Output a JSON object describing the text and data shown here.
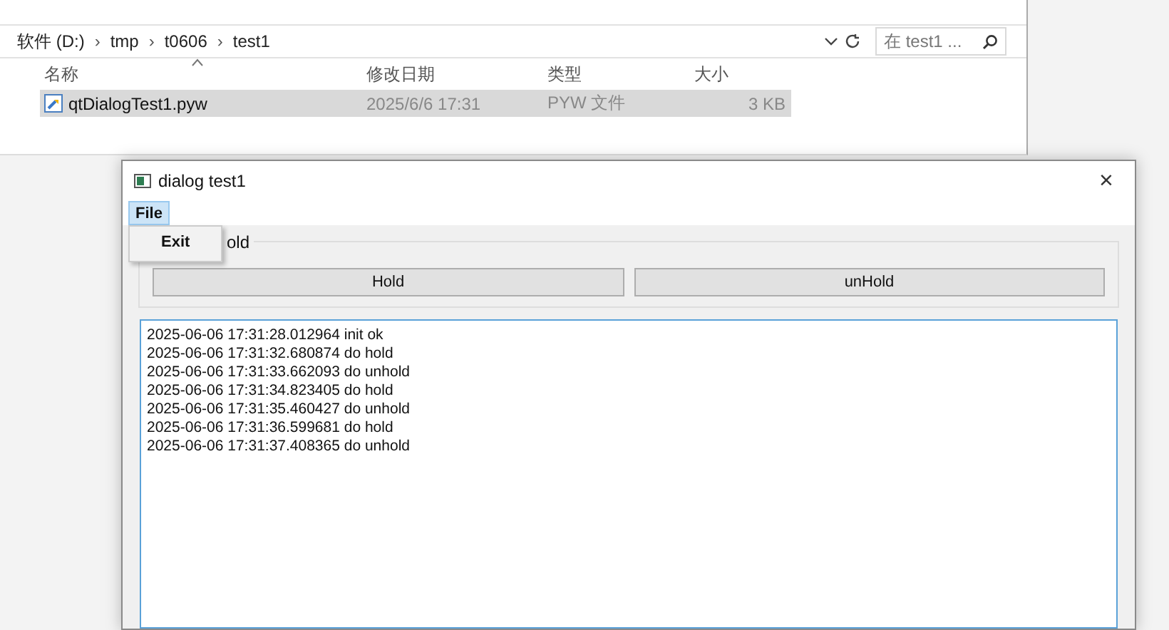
{
  "explorer": {
    "breadcrumb": [
      "软件 (D:)",
      "tmp",
      "t0606",
      "test1"
    ],
    "separator": "›",
    "search": {
      "placeholder": "在 test1 ..."
    },
    "columns": [
      {
        "label": "名称",
        "sorted": true
      },
      {
        "label": "修改日期",
        "sorted": false
      },
      {
        "label": "类型",
        "sorted": false
      },
      {
        "label": "大小",
        "sorted": false
      }
    ],
    "rows": [
      {
        "name": "qtDialogTest1.pyw",
        "modified": "2025/6/6 17:31",
        "type": "PYW 文件",
        "size": "3 KB",
        "selected": true
      }
    ]
  },
  "dialog": {
    "title": "dialog test1",
    "close": "×",
    "menu": [
      {
        "label": "File",
        "selected": true
      }
    ],
    "open_menu": {
      "items": [
        "Exit"
      ]
    },
    "group": {
      "title": "old",
      "buttons": [
        "Hold",
        "unHold"
      ]
    },
    "log": [
      "2025-06-06 17:31:28.012964 init ok",
      "2025-06-06 17:31:32.680874 do hold",
      "2025-06-06 17:31:33.662093 do unhold",
      "2025-06-06 17:31:34.823405 do hold",
      "2025-06-06 17:31:35.460427 do unhold",
      "2025-06-06 17:31:36.599681 do hold",
      "2025-06-06 17:31:37.408365 do unhold"
    ]
  }
}
